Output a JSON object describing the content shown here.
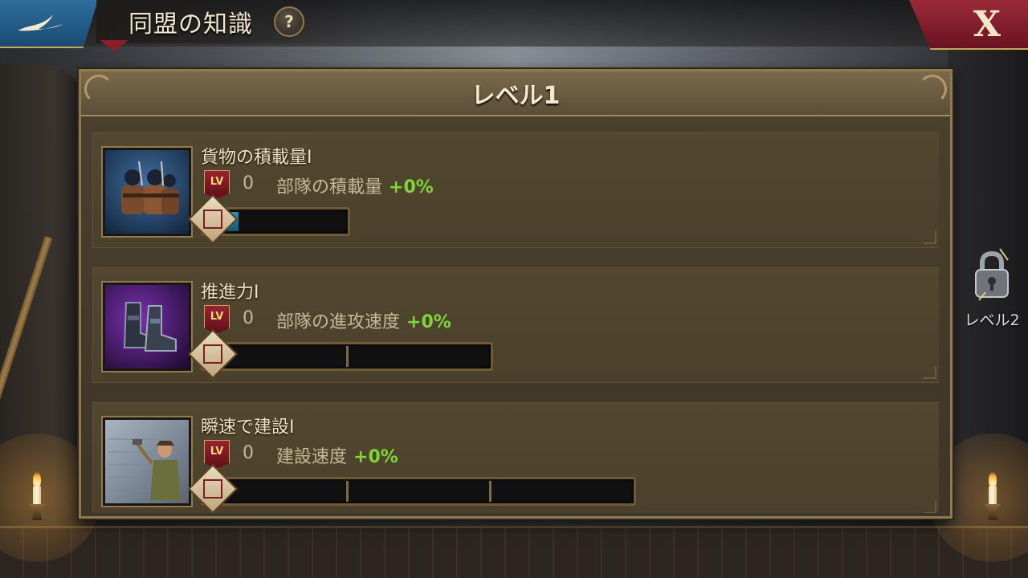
{
  "header": {
    "title": "同盟の知識",
    "help_label": "?",
    "close_label": "X"
  },
  "panel": {
    "title": "レベル1"
  },
  "lv_badge_text": "LV",
  "skills": [
    {
      "name": "貨物の積載量I",
      "level": "0",
      "effect_label": "部隊の積載量",
      "bonus": "+0%",
      "icon": "soldiers-with-backpacks-icon",
      "progress": 0.09,
      "segments": 1
    },
    {
      "name": "推進力I",
      "level": "0",
      "effect_label": "部隊の進攻速度",
      "bonus": "+0%",
      "icon": "armored-boots-icon",
      "progress": 0,
      "segments": 2
    },
    {
      "name": "瞬速で建設I",
      "level": "0",
      "effect_label": "建設速度",
      "bonus": "+0%",
      "icon": "builder-hammering-wall-icon",
      "progress": 0,
      "segments": 3
    }
  ],
  "next_level": {
    "label": "レベル2",
    "icon": "padlock-icon",
    "locked": true
  },
  "colors": {
    "bonus": "#7fd43a",
    "progress_fill": "#2a8fb3",
    "frame_gold": "#8f7a52"
  }
}
